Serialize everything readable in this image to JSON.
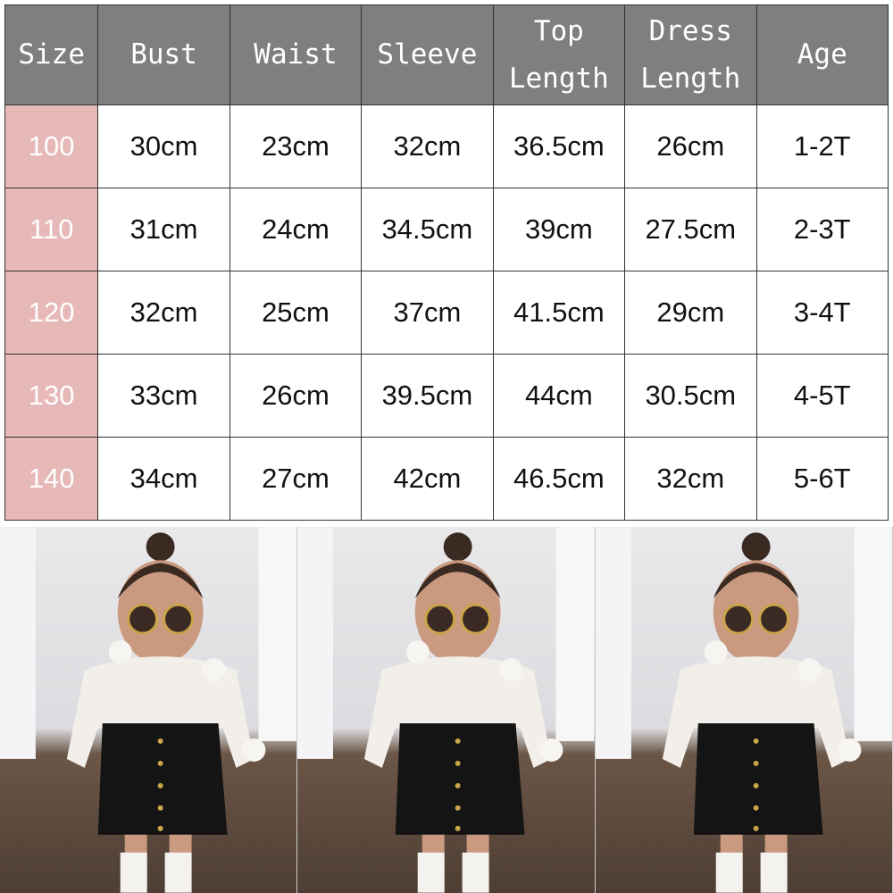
{
  "table": {
    "headers": [
      "Size",
      "Bust",
      "Waist",
      "Sleeve",
      "Top Length",
      "Dress Length",
      "Age"
    ],
    "rows": [
      [
        "100",
        "30cm",
        "23cm",
        "32cm",
        "36.5cm",
        "26cm",
        "1-2T"
      ],
      [
        "110",
        "31cm",
        "24cm",
        "34.5cm",
        "39cm",
        "27.5cm",
        "2-3T"
      ],
      [
        "120",
        "32cm",
        "25cm",
        "37cm",
        "41.5cm",
        "29cm",
        "3-4T"
      ],
      [
        "130",
        "33cm",
        "26cm",
        "39.5cm",
        "44cm",
        "30.5cm",
        "4-5T"
      ],
      [
        "140",
        "34cm",
        "27cm",
        "42cm",
        "46.5cm",
        "32cm",
        "5-6T"
      ]
    ]
  },
  "colors": {
    "header_bg": "#7f7f7f",
    "size_bg": "#e6b8b7"
  },
  "photos": [
    "toddler-outfit-photo",
    "toddler-outfit-photo",
    "toddler-outfit-photo"
  ]
}
